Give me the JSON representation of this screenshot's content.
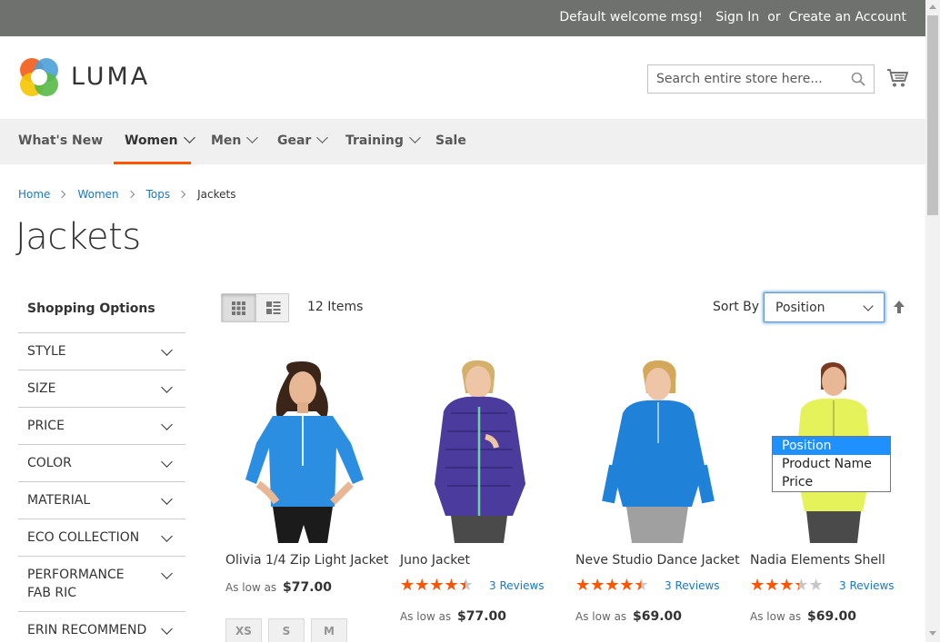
{
  "topbar": {
    "welcome": "Default welcome msg!",
    "sign_in": "Sign In",
    "or": "or",
    "create_account": "Create an Account",
    "bg_color": "#6e716e"
  },
  "header": {
    "logo_text": "LUMA",
    "search_placeholder": "Search entire store here...",
    "icons": [
      "search-icon",
      "cart-icon"
    ]
  },
  "nav": {
    "items": [
      {
        "label": "What's New",
        "dropdown": false,
        "active": false
      },
      {
        "label": "Women",
        "dropdown": true,
        "active": true
      },
      {
        "label": "Men",
        "dropdown": true,
        "active": false
      },
      {
        "label": "Gear",
        "dropdown": true,
        "active": false
      },
      {
        "label": "Training",
        "dropdown": true,
        "active": false
      },
      {
        "label": "Sale",
        "dropdown": false,
        "active": false
      }
    ],
    "accent_color": "#ff5501"
  },
  "breadcrumb": {
    "items": [
      "Home",
      "Women",
      "Tops"
    ],
    "current": "Jackets"
  },
  "page": {
    "title": "Jackets"
  },
  "sidebar": {
    "heading": "Shopping Options",
    "filters": [
      "STYLE",
      "SIZE",
      "PRICE",
      "COLOR",
      "MATERIAL",
      "ECO COLLECTION",
      "PERFORMANCE FAB RIC",
      "ERIN RECOMMEND"
    ]
  },
  "toolbar": {
    "count": "12 Items",
    "sort_label": "Sort By",
    "sort_value": "Position",
    "sort_options": [
      "Position",
      "Product Name",
      "Price"
    ],
    "selected_option": "Position",
    "view_modes": [
      "grid-icon",
      "list-icon"
    ]
  },
  "products": [
    {
      "name": "Olivia 1/4 Zip Light Jacket",
      "price_prefix": "As low as",
      "price": "$77.00",
      "rating": null,
      "reviews": null,
      "sizes": [
        "XS",
        "S",
        "M"
      ]
    },
    {
      "name": "Juno Jacket",
      "price_prefix": "As low as",
      "price": "$77.00",
      "rating": 0.8,
      "reviews": "3 Reviews"
    },
    {
      "name": "Neve Studio Dance Jacket",
      "price_prefix": "As low as",
      "price": "$69.00",
      "rating": 0.8,
      "reviews": "3 Reviews"
    },
    {
      "name": "Nadia Elements Shell",
      "price_prefix": "As low as",
      "price": "$69.00",
      "rating": 0.6,
      "reviews": "3 Reviews"
    }
  ],
  "colors": {
    "link": "#1979c3",
    "star": "#ff5501",
    "jacket_blue": "#2c8ee0",
    "jacket_purple": "#4b3b9c",
    "jacket_yellow": "#e6f25a"
  }
}
